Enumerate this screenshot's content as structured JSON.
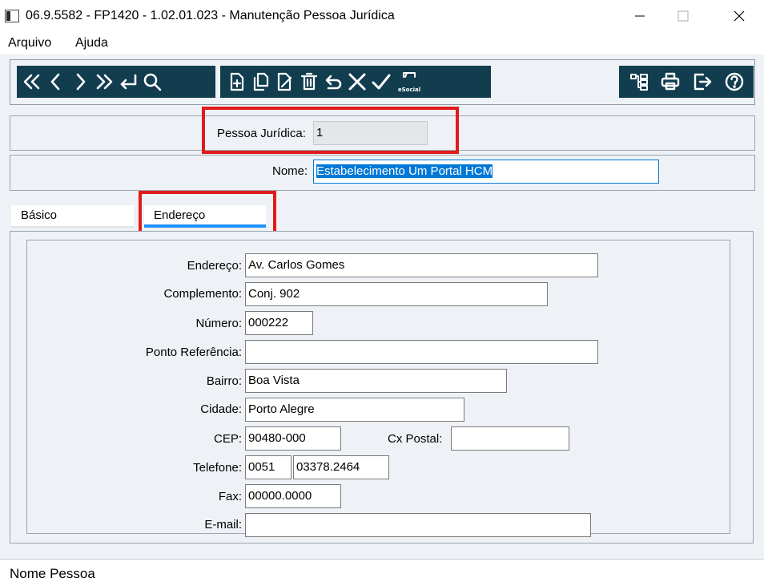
{
  "window": {
    "title": "06.9.5582 - FP1420 - 1.02.01.023 - Manutenção Pessoa Jurídica"
  },
  "menu": {
    "items": [
      "Arquivo",
      "Ajuda"
    ]
  },
  "toolbar": {
    "nav_icons": [
      "first-icon",
      "previous-icon",
      "next-icon",
      "last-icon",
      "return-icon",
      "search-icon"
    ],
    "action_icons": [
      "new-icon",
      "copy-icon",
      "edit-icon",
      "delete-icon",
      "undo-icon",
      "cancel-icon",
      "confirm-icon",
      "esocial-icon"
    ],
    "esocial_label": "eSocial",
    "right_icons": [
      "structure-icon",
      "print-icon",
      "exit-icon",
      "help-icon"
    ],
    "bg_color": "#113d4f"
  },
  "header": {
    "pessoa_label": "Pessoa Jurídica:",
    "pessoa_value": "1",
    "nome_label": "Nome:",
    "nome_value": "Estabelecimento Um Portal HCM"
  },
  "tabs": [
    {
      "label": "Básico",
      "active": false
    },
    {
      "label": "Endereço",
      "active": true
    }
  ],
  "form": {
    "endereco_label": "Endereço:",
    "endereco_value": "Av. Carlos Gomes",
    "complemento_label": "Complemento:",
    "complemento_value": "Conj. 902",
    "numero_label": "Número:",
    "numero_value": "000222",
    "ponto_label": "Ponto Referência:",
    "ponto_value": "",
    "bairro_label": "Bairro:",
    "bairro_value": "Boa Vista",
    "cidade_label": "Cidade:",
    "cidade_value": "Porto Alegre",
    "cep_label": "CEP:",
    "cep_value": "90480-000",
    "cxpostal_label": "Cx Postal:",
    "cxpostal_value": "",
    "telefone_label": "Telefone:",
    "telefone_ddd": "0051",
    "telefone_value": "03378.2464",
    "fax_label": "Fax:",
    "fax_value": "00000.0000",
    "email_label": "E-mail:",
    "email_value": ""
  },
  "status": {
    "text": "Nome Pessoa"
  },
  "colors": {
    "highlight": "#e01b1b",
    "selection": "#0078d7",
    "active_tab": "#1e90ff"
  }
}
